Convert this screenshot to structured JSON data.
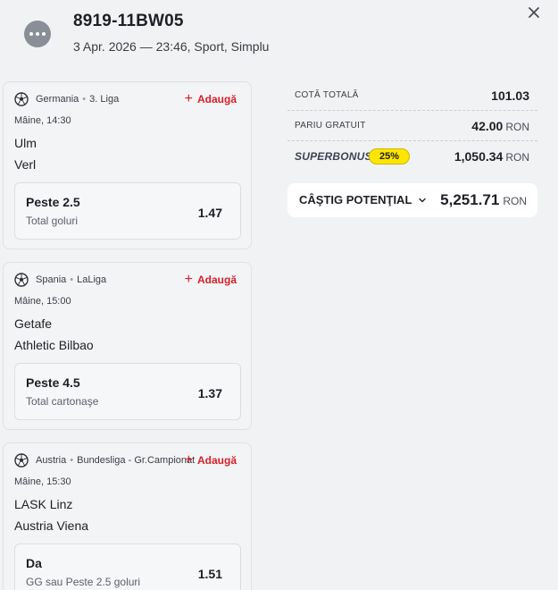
{
  "header": {
    "ticket_id": "8919-11BW05",
    "meta": "3 Apr. 2026 — 23:46, Sport, Simplu"
  },
  "add_label": "Adaugă",
  "events": [
    {
      "country": "Germania",
      "league": "3. Liga",
      "time": "Mâine, 14:30",
      "team1": "Ulm",
      "team2": "Verl",
      "selection": "Peste 2.5",
      "market": "Total goluri",
      "odd": "1.47"
    },
    {
      "country": "Spania",
      "league": "LaLiga",
      "time": "Mâine, 15:00",
      "team1": "Getafe",
      "team2": "Athletic Bilbao",
      "selection": "Peste 4.5",
      "market": "Total cartonaşe",
      "odd": "1.37"
    },
    {
      "country": "Austria",
      "league": "Bundesliga - Gr.Campionat",
      "time": "Mâine, 15:30",
      "team1": "LASK Linz",
      "team2": "Austria Viena",
      "selection": "Da",
      "market": "GG sau Peste 2.5 goluri",
      "odd": "1.51"
    }
  ],
  "summary": {
    "total_odds_label": "COTĂ TOTALĂ",
    "total_odds_value": "101.03",
    "free_bet_label": "PARIU GRATUIT",
    "free_bet_value": "42.00",
    "currency": "RON",
    "superbonus_label": "SUPERBONUS",
    "superbonus_percent": "25%",
    "superbonus_value": "1,050.34",
    "potential_label": "CÂŞTIG POTENŢIAL",
    "potential_value": "5,251.71"
  },
  "colors": {
    "accent_red": "#d4202a",
    "badge_yellow": "#ffe600",
    "background": "#f1f2f4"
  },
  "icons": {
    "menu": "more-dots-icon",
    "close": "close-icon",
    "sport": "soccer-ball-icon",
    "add": "plus-icon",
    "expand": "chevron-down-icon"
  }
}
